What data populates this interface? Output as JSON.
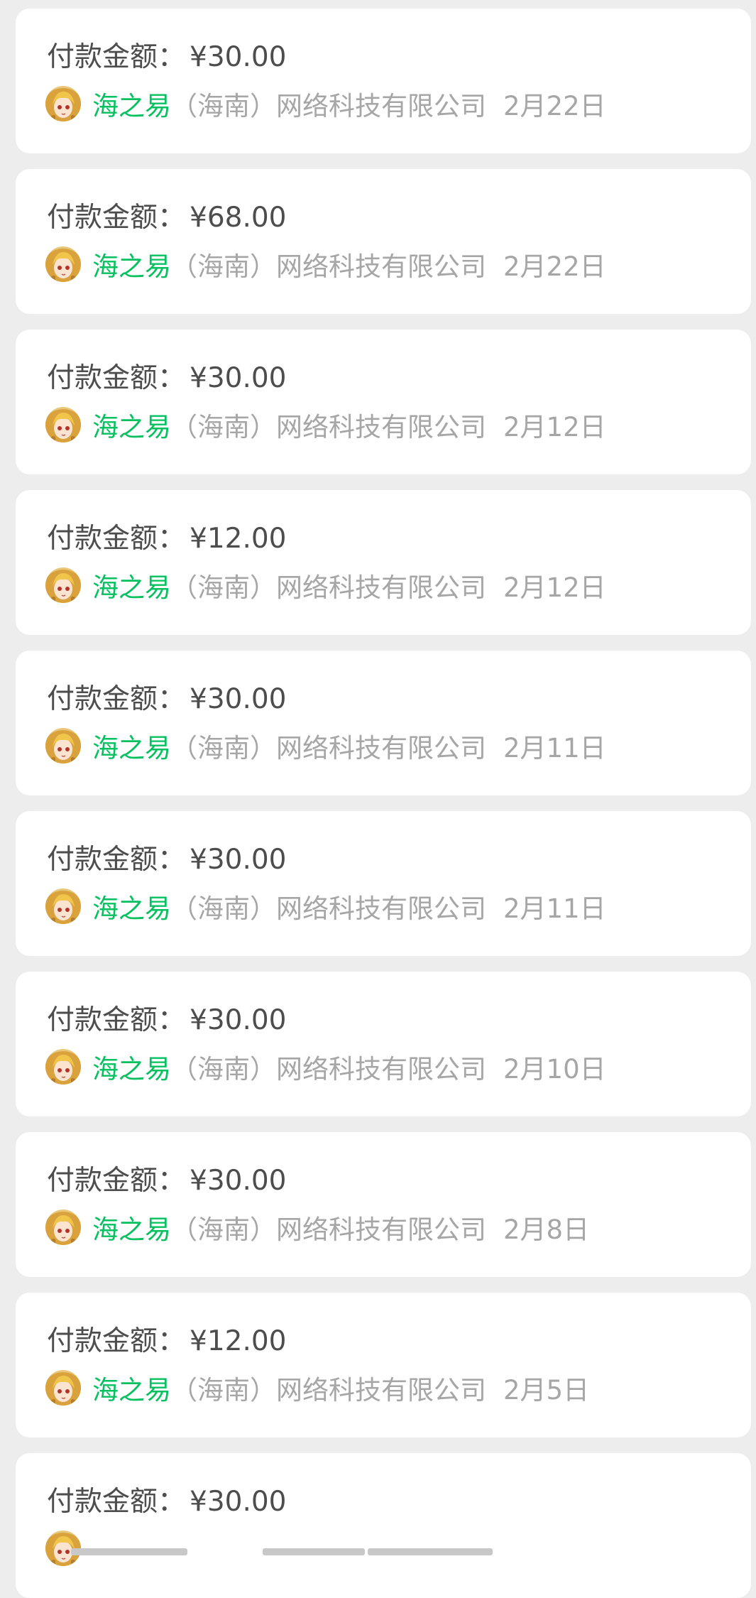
{
  "transactions": [
    {
      "label": "付款金额：",
      "amount": "¥30.00",
      "merchant_name": "海之易",
      "merchant_rest": "（海南）网络科技有限公司",
      "date": "2月22日"
    },
    {
      "label": "付款金额：",
      "amount": "¥68.00",
      "merchant_name": "海之易",
      "merchant_rest": "（海南）网络科技有限公司",
      "date": "2月22日"
    },
    {
      "label": "付款金额：",
      "amount": "¥30.00",
      "merchant_name": "海之易",
      "merchant_rest": "（海南）网络科技有限公司",
      "date": "2月12日"
    },
    {
      "label": "付款金额：",
      "amount": "¥12.00",
      "merchant_name": "海之易",
      "merchant_rest": "（海南）网络科技有限公司",
      "date": "2月12日"
    },
    {
      "label": "付款金额：",
      "amount": "¥30.00",
      "merchant_name": "海之易",
      "merchant_rest": "（海南）网络科技有限公司",
      "date": "2月11日"
    },
    {
      "label": "付款金额：",
      "amount": "¥30.00",
      "merchant_name": "海之易",
      "merchant_rest": "（海南）网络科技有限公司",
      "date": "2月11日"
    },
    {
      "label": "付款金额：",
      "amount": "¥30.00",
      "merchant_name": "海之易",
      "merchant_rest": "（海南）网络科技有限公司",
      "date": "2月10日"
    },
    {
      "label": "付款金额：",
      "amount": "¥30.00",
      "merchant_name": "海之易",
      "merchant_rest": "（海南）网络科技有限公司",
      "date": "2月8日"
    },
    {
      "label": "付款金额：",
      "amount": "¥12.00",
      "merchant_name": "海之易",
      "merchant_rest": "（海南）网络科技有限公司",
      "date": "2月5日"
    },
    {
      "label": "付款金额：",
      "amount": "¥30.00"
    }
  ],
  "colors": {
    "background": "#ededed",
    "card": "#ffffff",
    "merchant_accent": "#07c160",
    "secondary_text": "#a6a6a6",
    "primary_text": "#4d4d4d"
  },
  "icons": {
    "avatar": "merchant-avatar-icon"
  }
}
